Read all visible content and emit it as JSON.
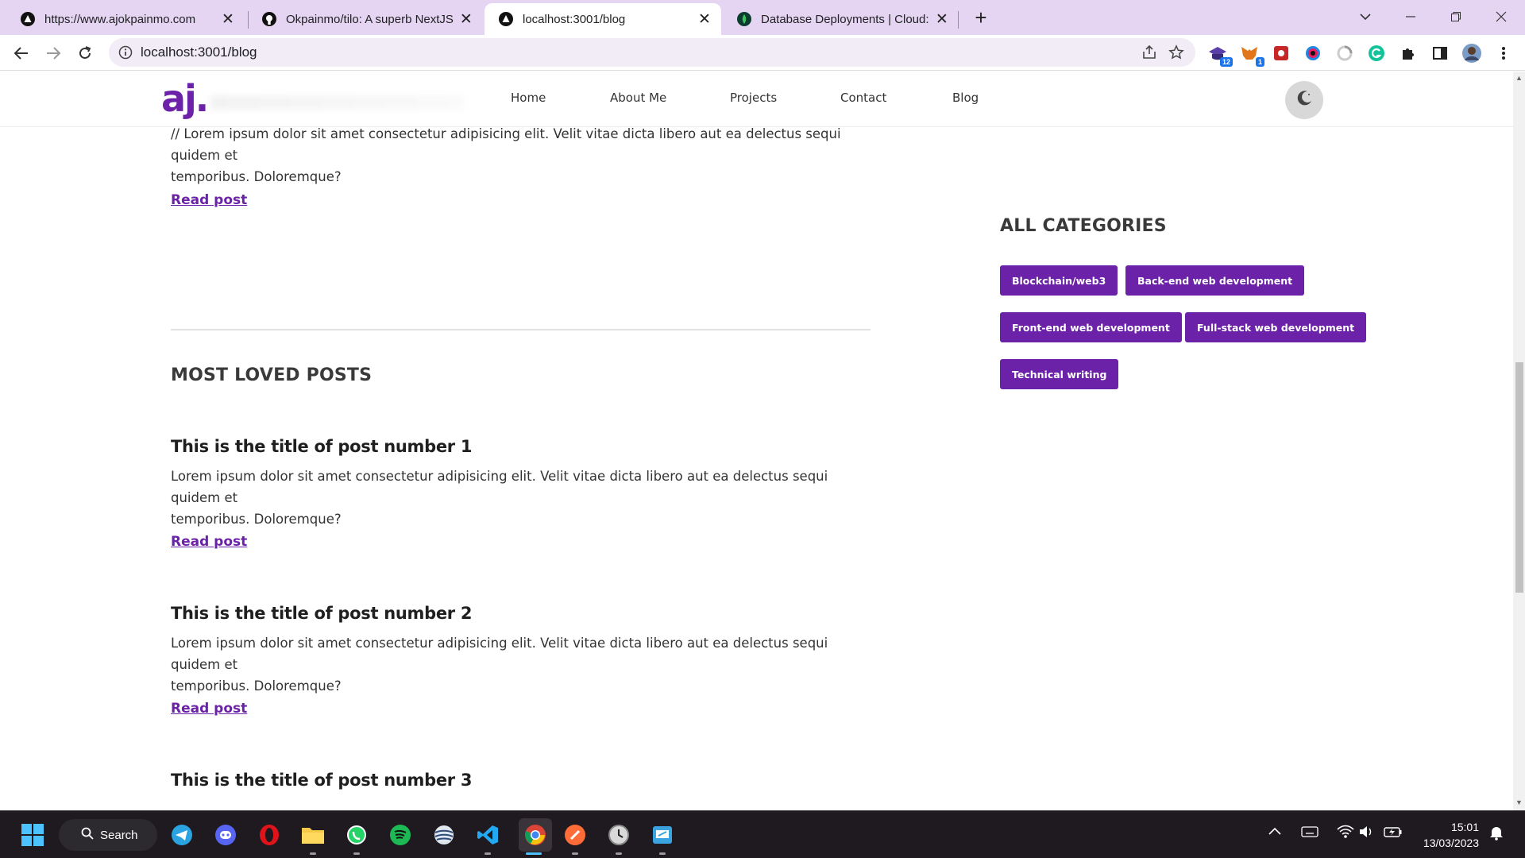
{
  "browser": {
    "tabs": [
      {
        "title": "https://www.ajokpainmo.com",
        "icon": "triangle-logo-icon",
        "active": false
      },
      {
        "title": "Okpainmo/tilo: A superb NextJS ...",
        "icon": "github-icon",
        "active": false
      },
      {
        "title": "localhost:3001/blog",
        "icon": "triangle-logo-icon",
        "active": true
      },
      {
        "title": "Database Deployments | Cloud: M",
        "icon": "mongodb-leaf-icon",
        "active": false
      }
    ],
    "new_tab_label": "+",
    "address": "localhost:3001/blog",
    "extensions": [
      {
        "name": "graduation-cap-extension-icon",
        "badge": "12"
      },
      {
        "name": "metamask-extension-icon",
        "badge": "1"
      },
      {
        "name": "red-square-extension-icon",
        "badge": ""
      },
      {
        "name": "circle-color-extension-icon",
        "badge": ""
      },
      {
        "name": "loader-extension-icon",
        "badge": ""
      },
      {
        "name": "grammarly-extension-icon",
        "badge": ""
      },
      {
        "name": "puzzle-extensions-icon",
        "badge": ""
      },
      {
        "name": "side-panel-icon",
        "badge": ""
      },
      {
        "name": "profile-avatar-icon",
        "badge": ""
      }
    ]
  },
  "site": {
    "logo": "aj.",
    "nav": [
      "Home",
      "About Me",
      "Projects",
      "Contact",
      "Blog"
    ],
    "theme_toggle_icon": "moon-icon"
  },
  "top_post": {
    "excerpt_line1": "// Lorem ipsum dolor sit amet consectetur adipisicing elit. Velit vitae dicta libero aut ea delectus sequi quidem et",
    "excerpt_line2": "temporibus. Doloremque?",
    "read_label": "Read post"
  },
  "most_loved": {
    "heading": "MOST LOVED POSTS",
    "posts": [
      {
        "title": "This is the title of post number 1",
        "line1": "Lorem ipsum dolor sit amet consectetur adipisicing elit. Velit vitae dicta libero aut ea delectus sequi quidem et",
        "line2": "temporibus. Doloremque?",
        "read_label": "Read post"
      },
      {
        "title": "This is the title of post number 2",
        "line1": "Lorem ipsum dolor sit amet consectetur adipisicing elit. Velit vitae dicta libero aut ea delectus sequi quidem et",
        "line2": "temporibus. Doloremque?",
        "read_label": "Read post"
      },
      {
        "title": "This is the title of post number 3"
      }
    ]
  },
  "categories": {
    "heading": "ALL CATEGORIES",
    "items": [
      "Blockchain/web3",
      "Back-end web development",
      "Front-end web development",
      "Full-stack web development",
      "Technical writing"
    ]
  },
  "taskbar": {
    "search_label": "Search",
    "apps": [
      "telegram-icon",
      "discord-icon",
      "opera-icon",
      "file-explorer-icon",
      "whatsapp-icon",
      "spotify-icon",
      "network-app-icon",
      "vscode-icon",
      "chrome-icon",
      "postman-icon",
      "clock-app-icon",
      "remote-desktop-icon"
    ],
    "time": "15:01",
    "date": "13/03/2023"
  },
  "colors": {
    "accent": "#6b21a8",
    "tabbar": "#e5d5f3",
    "taskbar": "#1f1a1f"
  }
}
